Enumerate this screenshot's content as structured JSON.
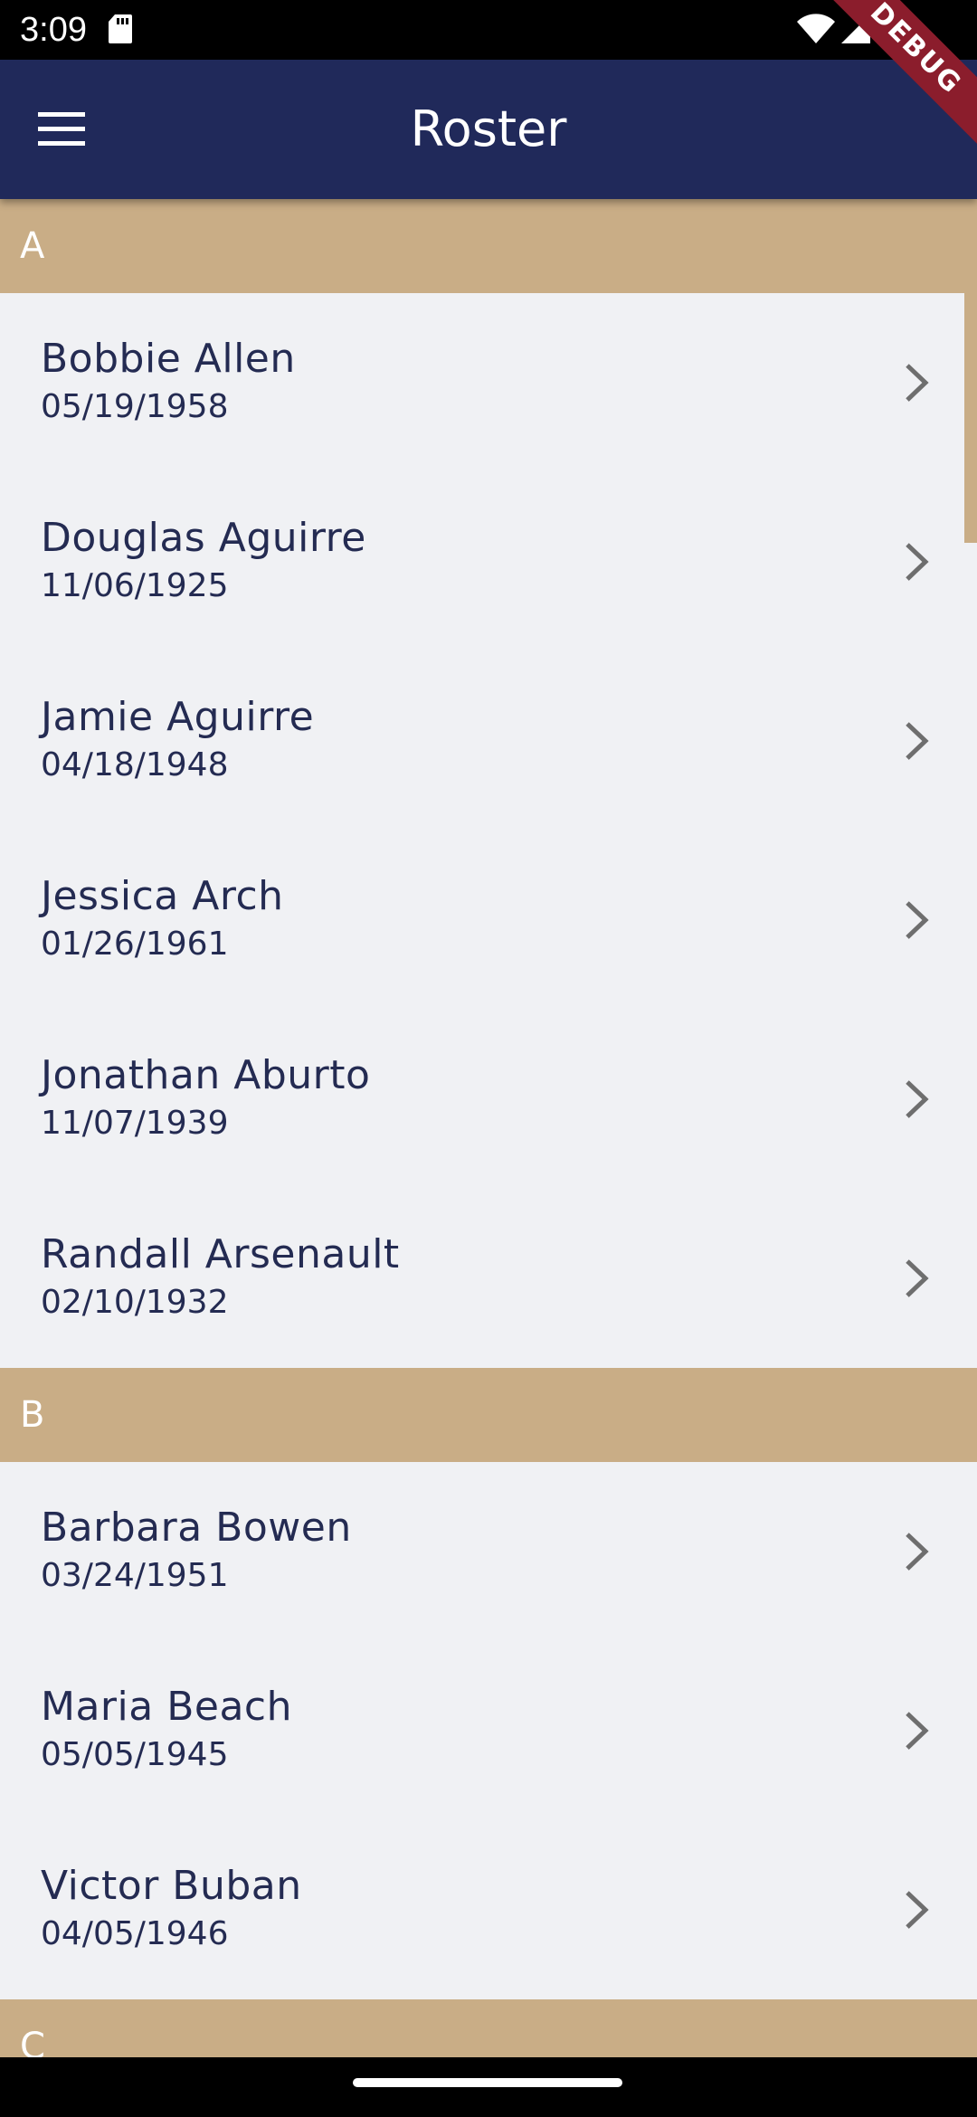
{
  "status_bar": {
    "time": "3:09"
  },
  "app_bar": {
    "title": "Roster",
    "debug_label": "DEBUG",
    "color": "#20295a"
  },
  "colors": {
    "section_header": "#c9ad86",
    "list_background": "#f0f1f4",
    "text": "#242b52",
    "chevron": "#6e6e6e"
  },
  "sections": [
    {
      "letter": "A",
      "people": [
        {
          "name": "Bobbie Allen",
          "date": "05/19/1958"
        },
        {
          "name": "Douglas Aguirre",
          "date": "11/06/1925"
        },
        {
          "name": "Jamie Aguirre",
          "date": "04/18/1948"
        },
        {
          "name": "Jessica Arch",
          "date": "01/26/1961"
        },
        {
          "name": "Jonathan Aburto",
          "date": "11/07/1939"
        },
        {
          "name": "Randall Arsenault",
          "date": "02/10/1932"
        }
      ]
    },
    {
      "letter": "B",
      "people": [
        {
          "name": "Barbara Bowen",
          "date": "03/24/1951"
        },
        {
          "name": "Maria Beach",
          "date": "05/05/1945"
        },
        {
          "name": "Victor Buban",
          "date": "04/05/1946"
        }
      ]
    },
    {
      "letter": "C",
      "people": []
    }
  ]
}
